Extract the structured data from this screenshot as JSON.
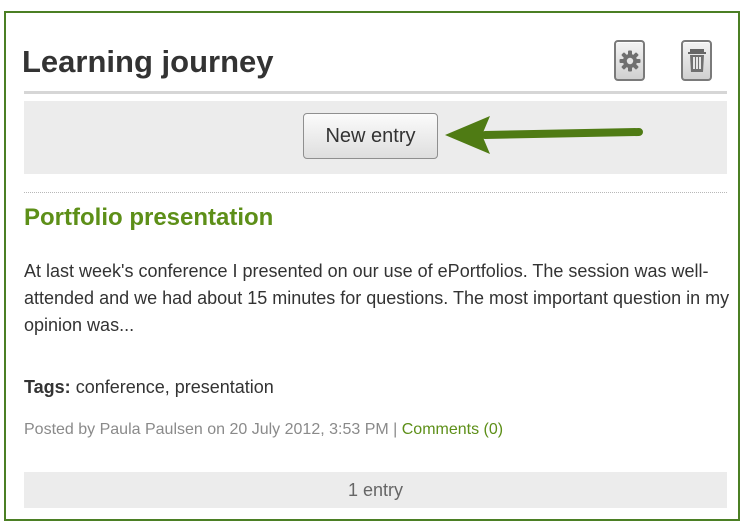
{
  "block": {
    "title": "Learning journey",
    "actions": {
      "settings_icon": "gear-icon",
      "delete_icon": "trash-icon"
    }
  },
  "toolbar": {
    "new_entry_label": "New entry",
    "annotation_icon": "left-arrow-icon"
  },
  "entry": {
    "title": "Portfolio presentation",
    "body": "At last week's conference I presented on our use of ePortfolios. The session was well-attended and we had about 15 minutes for questions. The most important question in my opinion was...",
    "tags_label": "Tags:",
    "tags": "conference, presentation",
    "posted_text": "Posted by Paula Paulsen on 20 July 2012, 3:53 PM",
    "separator": "|",
    "comments_label": "Comments (0)"
  },
  "footer": {
    "count_text": "1 entry"
  },
  "colors": {
    "border": "#4b7f24",
    "accent": "#5d8f18",
    "panel": "#ececec",
    "annotation": "#4f7b14"
  }
}
